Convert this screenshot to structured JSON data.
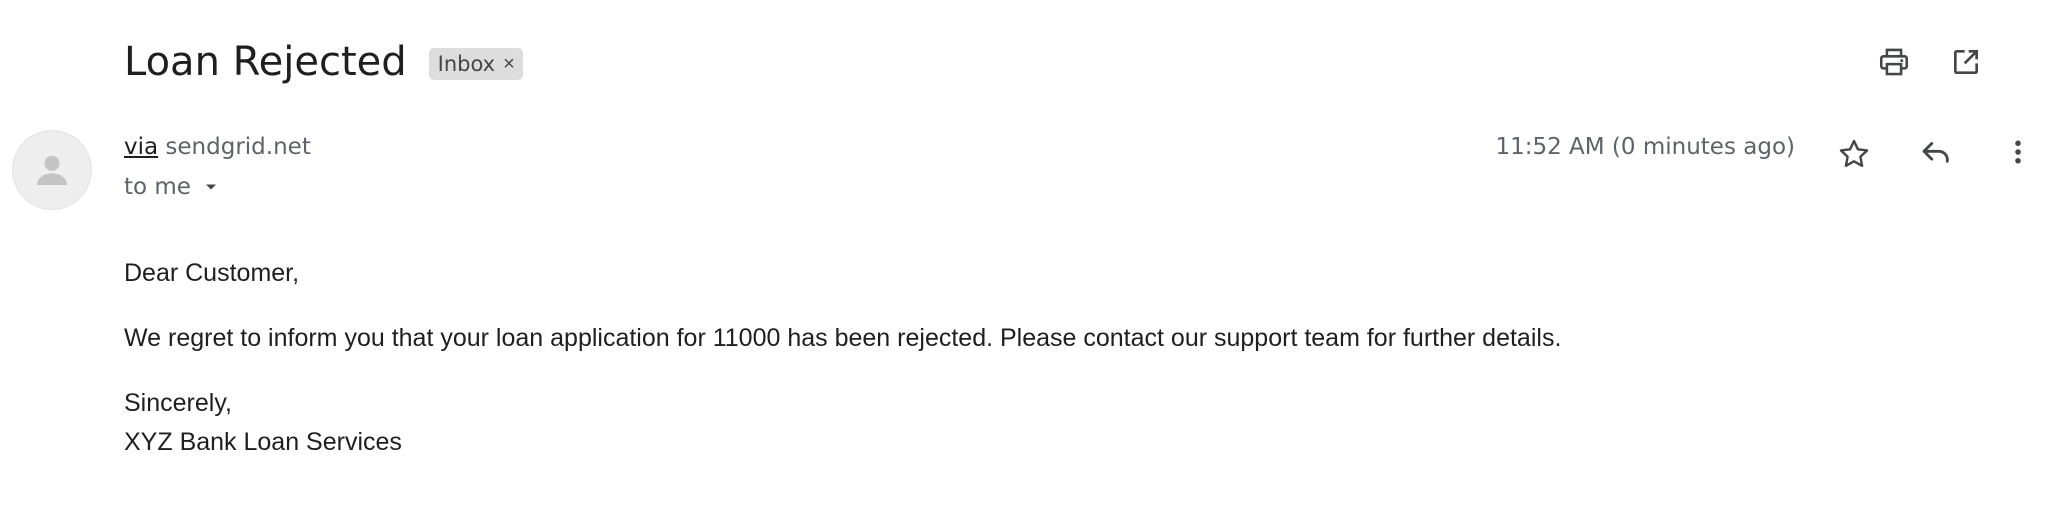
{
  "email": {
    "subject": "Loan Rejected",
    "label": "Inbox",
    "label_remove": "×",
    "sender": {
      "via_text": "via",
      "domain": "sendgrid.net"
    },
    "recipient": "to me",
    "timestamp": "11:52 AM (0 minutes ago)",
    "body": {
      "greeting": "Dear Customer,",
      "paragraph": "We regret to inform you that your loan application for 11000 has been rejected. Please contact our support team for further details.",
      "closing": "Sincerely,",
      "signature": "XYZ Bank Loan Services"
    }
  },
  "icons": {
    "print": "print-icon",
    "open_new_window": "open-in-new-window-icon",
    "avatar": "person-icon",
    "dropdown": "caret-down-icon",
    "star": "star-icon",
    "reply": "reply-icon",
    "more": "more-vert-icon"
  },
  "colors": {
    "text_primary": "#1f1f1f",
    "text_secondary": "#5f6368",
    "chip_bg": "#dddddd",
    "avatar_bg": "#eeeeee"
  }
}
